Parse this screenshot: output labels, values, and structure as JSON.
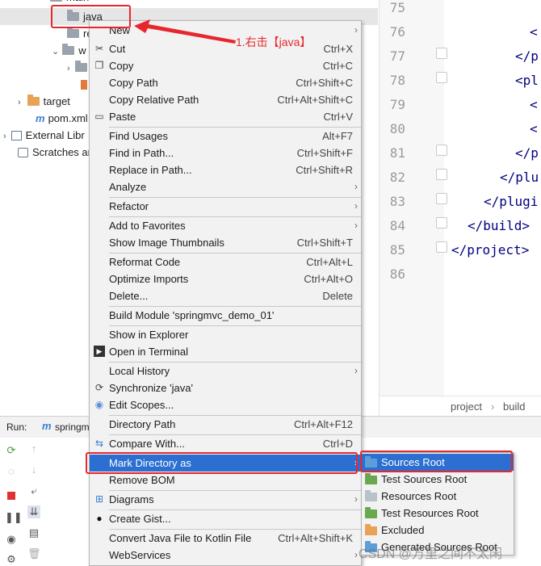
{
  "tree": {
    "main": "main",
    "java": "java",
    "resources": "re",
    "webapp": "w",
    "target": "target",
    "pom": "pom.xml",
    "external_libs": "External Libr",
    "scratches": "Scratches ar"
  },
  "editor": {
    "line_numbers": [
      "75",
      "76",
      "77",
      "78",
      "79",
      "80",
      "81",
      "82",
      "83",
      "84",
      "85",
      "86"
    ],
    "code": {
      "l76": "<",
      "l77": "</p",
      "l78": "<pl",
      "l79": "<",
      "l80": "<",
      "l81": "</p",
      "l82": "</plu",
      "l83": "</plugi",
      "l84": "</build>",
      "l85": "</project>"
    },
    "breadcrumb": [
      "project",
      "build"
    ]
  },
  "run": {
    "label": "Run:",
    "config": "springm"
  },
  "menu": {
    "new": "New",
    "cut": "Cut",
    "cut_sc": "Ctrl+X",
    "copy": "Copy",
    "copy_sc": "Ctrl+C",
    "copy_path": "Copy Path",
    "copy_path_sc": "Ctrl+Shift+C",
    "copy_relative_path": "Copy Relative Path",
    "copy_relative_path_sc": "Ctrl+Alt+Shift+C",
    "paste": "Paste",
    "paste_sc": "Ctrl+V",
    "find_usages": "Find Usages",
    "find_usages_sc": "Alt+F7",
    "find_in_path": "Find in Path...",
    "find_in_path_sc": "Ctrl+Shift+F",
    "replace_in_path": "Replace in Path...",
    "replace_in_path_sc": "Ctrl+Shift+R",
    "analyze": "Analyze",
    "refactor": "Refactor",
    "add_to_favorites": "Add to Favorites",
    "show_thumbnails": "Show Image Thumbnails",
    "show_thumbnails_sc": "Ctrl+Shift+T",
    "reformat_code": "Reformat Code",
    "reformat_code_sc": "Ctrl+Alt+L",
    "optimize_imports": "Optimize Imports",
    "optimize_imports_sc": "Ctrl+Alt+O",
    "delete": "Delete...",
    "delete_sc": "Delete",
    "build_module": "Build Module 'springmvc_demo_01'",
    "show_in_explorer": "Show in Explorer",
    "open_in_terminal": "Open in Terminal",
    "local_history": "Local History",
    "synchronize": "Synchronize 'java'",
    "edit_scopes": "Edit Scopes...",
    "directory_path": "Directory Path",
    "directory_path_sc": "Ctrl+Alt+F12",
    "compare_with": "Compare With...",
    "compare_with_sc": "Ctrl+D",
    "mark_directory_as": "Mark Directory as",
    "remove_bom": "Remove BOM",
    "diagrams": "Diagrams",
    "create_gist": "Create Gist...",
    "convert_kotlin": "Convert Java File to Kotlin File",
    "convert_kotlin_sc": "Ctrl+Alt+Shift+K",
    "webservices": "WebServices"
  },
  "submenu": {
    "sources_root": "Sources Root",
    "test_sources_root": "Test Sources Root",
    "resources_root": "Resources Root",
    "test_resources_root": "Test Resources Root",
    "excluded": "Excluded",
    "generated_sources_root": "Generated Sources Root"
  },
  "annotation": "1.右击【java】",
  "watermark": "CSDN @万里之间不太闲",
  "colors": {
    "highlight": "#2c6fd1",
    "annotation_red": "#e8262d"
  }
}
